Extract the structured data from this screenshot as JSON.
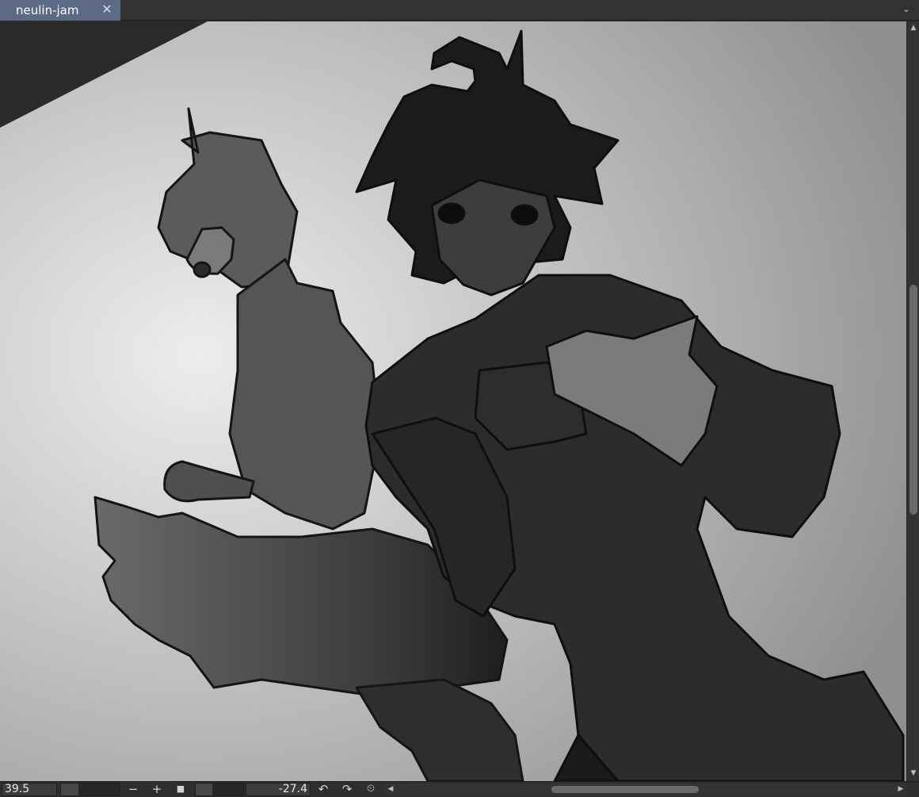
{
  "tab": {
    "title": "neulin-jam",
    "close_glyph": "✕",
    "menu_glyph": "⌄"
  },
  "canvas": {
    "artwork": "grayscale illustration of two characters",
    "colors": {
      "paper_light": "#e6e6e6",
      "paper_dark": "#9a9a9a",
      "ink": "#111111",
      "tab_active": "#5d6a86"
    }
  },
  "statusbar": {
    "zoom_value": "39.5",
    "zoom_level_fraction": 0.3,
    "zoom_out_glyph": "−",
    "zoom_in_glyph": "+",
    "fit_glyph": "■",
    "rotation_value": "-27.4",
    "rotation_level_fraction": 0.35,
    "rotate_left_glyph": "↶",
    "rotate_right_glyph": "↷",
    "reset_rotation_glyph": "⏲"
  },
  "icons": {
    "tab_close": "close-icon",
    "tab_menu": "chevron-down-icon",
    "scroll_up": "arrow-up-icon",
    "scroll_down": "arrow-down-icon",
    "scroll_left": "arrow-left-icon",
    "scroll_right": "arrow-right-icon"
  }
}
